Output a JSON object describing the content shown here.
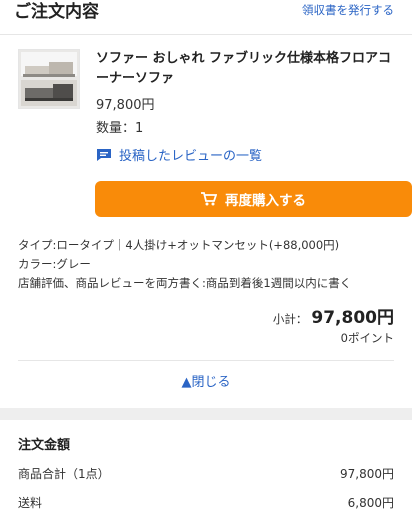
{
  "header": {
    "title": "ご注文内容",
    "receipt_link": "領収書を発行する"
  },
  "product": {
    "name": "ソファー おしゃれ ファブリック仕様本格フロアコーナーソファ",
    "price": "97,800円",
    "quantity": "数量：1",
    "review_link": "投稿したレビューの一覧"
  },
  "rebuy_button": "再度購入する",
  "options": {
    "type": "タイプ:ロータイプ｜4人掛け+オットマンセット(+88,000円)",
    "color": "カラー:グレー",
    "note": "店舗評価、商品レビューを両方書く:商品到着後1週間以内に書く"
  },
  "subtotal": {
    "label": "小計：",
    "value": "97,800円",
    "points": "0ポイント"
  },
  "close_link": "▲閉じる",
  "totals": {
    "title": "注文金額",
    "rows": [
      {
        "label": "商品合計（1点）",
        "value": "97,800円"
      },
      {
        "label": "送料",
        "value": "6,800円"
      }
    ]
  },
  "colors": {
    "accent_orange": "#f98b09",
    "link_blue": "#2a64c5"
  },
  "icons": [
    "comment-icon",
    "cart-icon"
  ]
}
